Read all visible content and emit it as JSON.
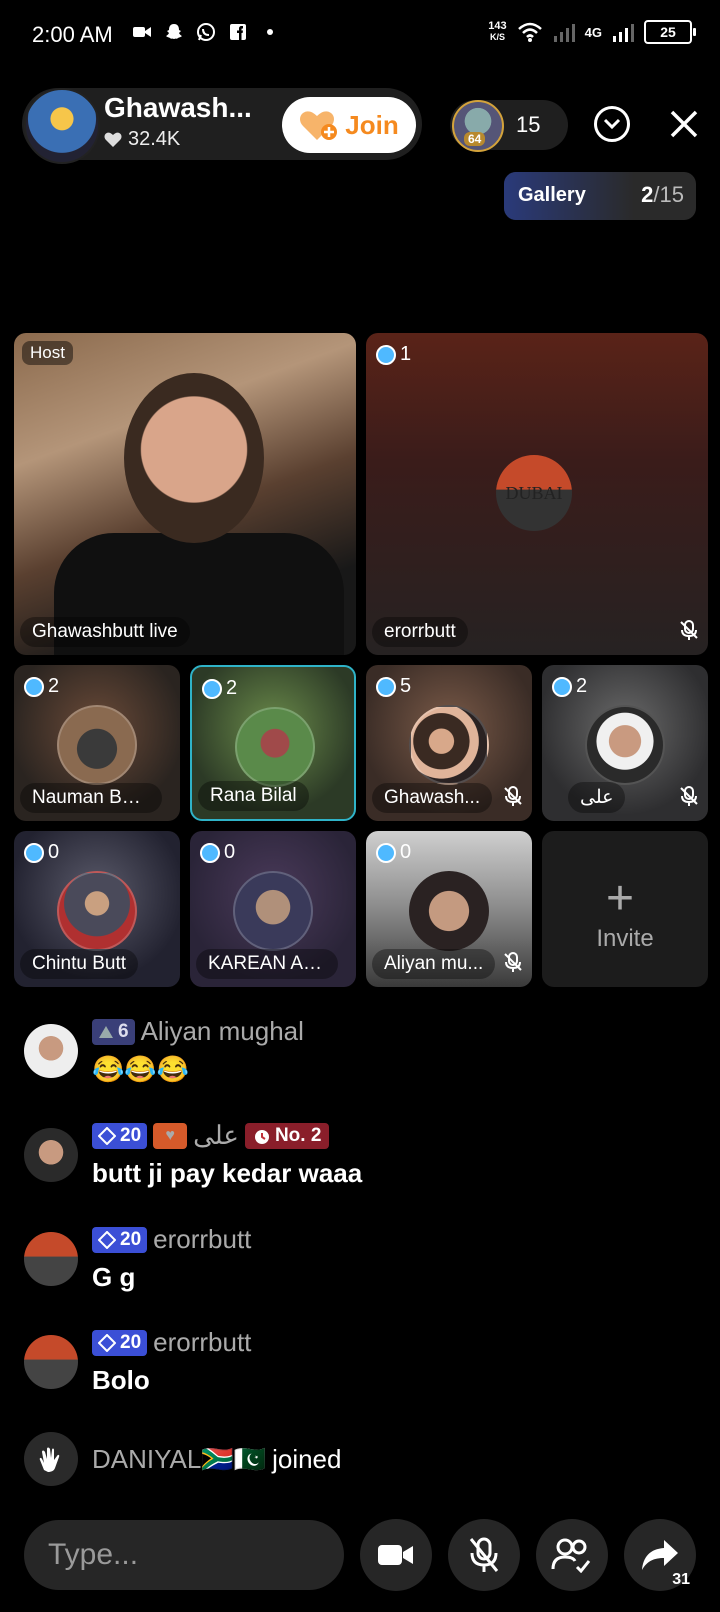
{
  "status_bar": {
    "time": "2:00 AM",
    "net_speed_value": "143",
    "net_speed_unit": "K/S",
    "network": "4G",
    "battery": "25"
  },
  "header": {
    "host_name": "Ghawash...",
    "host_likes": "32.4K",
    "join_label": "Join",
    "viewer_level": "64",
    "viewer_count": "15"
  },
  "gallery": {
    "label": "Gallery",
    "current": "2",
    "total": "/15"
  },
  "tiles": {
    "host": {
      "tag": "Host",
      "name": "Ghawashbutt live"
    },
    "seat1": {
      "num": "1",
      "name": "erorrbutt",
      "logo_text": "DUBAI"
    },
    "seats": [
      {
        "num": "2",
        "name": "Nauman But..."
      },
      {
        "num": "2",
        "name": "Rana Bilal"
      },
      {
        "num": "5",
        "name": "Ghawash..."
      },
      {
        "num": "2",
        "name": "علی"
      },
      {
        "num": "0",
        "name": "Chintu Butt"
      },
      {
        "num": "0",
        "name": "KAREAN AN..."
      },
      {
        "num": "0",
        "name": "Aliyan mu..."
      }
    ],
    "invite": {
      "label": "Invite"
    }
  },
  "chat": [
    {
      "level": "6",
      "name": "Aliyan mughal",
      "text": "😂😂😂"
    },
    {
      "level": "20",
      "name": "علی",
      "rank": "No. 2",
      "text": "butt ji pay kedar waaa"
    },
    {
      "level": "20",
      "name": "erorrbutt",
      "text": "G g"
    },
    {
      "level": "20",
      "name": "erorrbutt",
      "text": "Bolo"
    }
  ],
  "join_notice": {
    "name": "DANIYAL🇿🇦🇵🇰",
    "action": "joined"
  },
  "bottom_bar": {
    "input_placeholder": "Type...",
    "share_count": "31"
  },
  "colors": {
    "join_text": "#f58a1f",
    "level_badge": "#3b4fd6",
    "rank_badge": "#8a1e2a",
    "selected_tile_border": "#2fb3c8"
  }
}
